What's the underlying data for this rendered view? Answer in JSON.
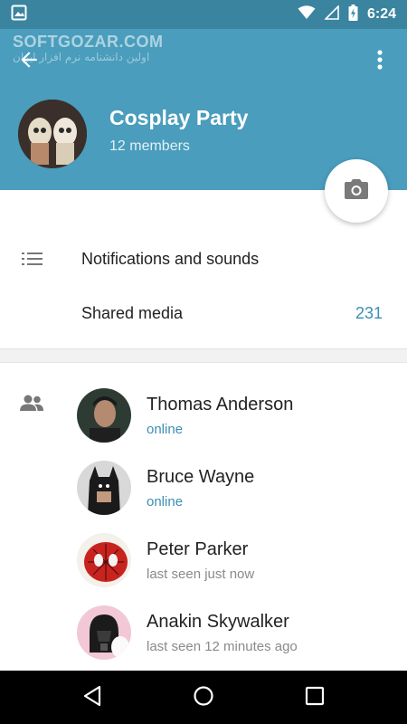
{
  "status_bar": {
    "time": "6:24",
    "icons": [
      "image-icon",
      "wifi-icon",
      "signal-icon",
      "battery-charging-icon"
    ]
  },
  "watermark": {
    "text": "SOFTGOZAR.COM",
    "subtext": "اولین دانشنامه نرم افزار ایران"
  },
  "app_bar": {
    "back_icon": "arrow-back-icon",
    "menu_icon": "more-vert-icon"
  },
  "group": {
    "title": "Cosplay Party",
    "subtitle": "12 members",
    "camera_icon": "camera-icon"
  },
  "settings": {
    "notifications_label": "Notifications and sounds",
    "shared_media_label": "Shared media",
    "shared_media_count": "231"
  },
  "members": [
    {
      "name": "Thomas Anderson",
      "status": "online",
      "status_type": "online"
    },
    {
      "name": "Bruce Wayne",
      "status": "online",
      "status_type": "online"
    },
    {
      "name": "Peter Parker",
      "status": "last seen just now",
      "status_type": "away"
    },
    {
      "name": "Anakin Skywalker",
      "status": "last seen 12 minutes ago",
      "status_type": "away"
    }
  ],
  "colors": {
    "status_bar": "#3a849f",
    "header": "#4a9dbc",
    "accent": "#3a8fb4",
    "nav_bar": "#000000"
  }
}
